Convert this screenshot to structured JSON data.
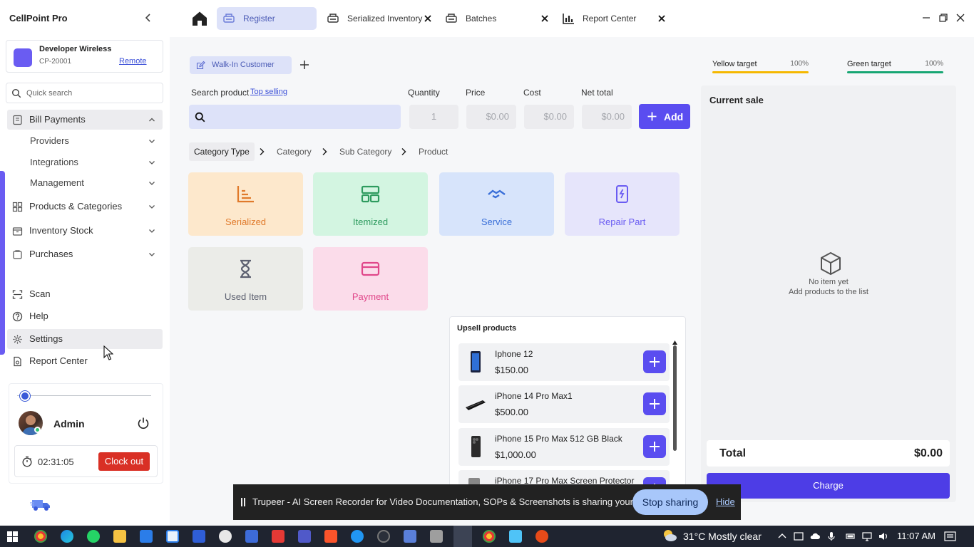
{
  "app": {
    "title": "CellPoint Pro"
  },
  "store": {
    "name": "Developer Wireless",
    "code": "CP-20001",
    "mode": "Remote"
  },
  "quick_search": {
    "placeholder": "Quick search"
  },
  "sidebar": {
    "items": [
      {
        "label": "Bill Payments",
        "icon": "receipt-icon",
        "expanded": true
      },
      {
        "label": "Providers",
        "sub": true
      },
      {
        "label": "Integrations",
        "sub": true
      },
      {
        "label": "Management",
        "sub": true
      },
      {
        "label": "Products & Categories",
        "icon": "grid-icon"
      },
      {
        "label": "Inventory Stock",
        "icon": "box-icon"
      },
      {
        "label": "Purchases",
        "icon": "cart-icon"
      },
      {
        "label": "Scan",
        "icon": "scan-icon"
      },
      {
        "label": "Help",
        "icon": "help-icon"
      },
      {
        "label": "Settings",
        "icon": "gear-icon"
      },
      {
        "label": "Report Center",
        "icon": "report-icon"
      }
    ]
  },
  "user": {
    "name": "Admin",
    "timer": "02:31:05",
    "clock_out": "Clock out"
  },
  "tabs": [
    {
      "label": "Register",
      "icon": "register-icon",
      "active": true
    },
    {
      "label": "Serialized Inventory",
      "icon": "printer-icon"
    },
    {
      "label": "Batches",
      "icon": "printer-icon"
    },
    {
      "label": "Report Center",
      "icon": "bar-chart-icon"
    }
  ],
  "customer": {
    "label": "Walk-In Customer"
  },
  "form": {
    "search_label": "Search product",
    "top_selling": "Top selling",
    "quantity_label": "Quantity",
    "quantity_value": "1",
    "price_label": "Price",
    "price_value": "$0.00",
    "cost_label": "Cost",
    "cost_value": "$0.00",
    "net_label": "Net total",
    "net_value": "$0.00",
    "add_label": "Add"
  },
  "breadcrumb": [
    "Category Type",
    "Category",
    "Sub Category",
    "Product"
  ],
  "categories": [
    {
      "label": "Serialized",
      "bg": "#fde8cc",
      "fg": "#e07a2b"
    },
    {
      "label": "Itemized",
      "bg": "#d3f5e1",
      "fg": "#2e9b5f"
    },
    {
      "label": "Service",
      "bg": "#d7e4fb",
      "fg": "#3a6fd8"
    },
    {
      "label": "Repair Part",
      "bg": "#e6e5fb",
      "fg": "#6a5cf2"
    },
    {
      "label": "Used Item",
      "bg": "#ebece8",
      "fg": "#5c6070"
    },
    {
      "label": "Payment",
      "bg": "#fbdcea",
      "fg": "#e0478a"
    }
  ],
  "upsell": {
    "title": "Upsell products",
    "items": [
      {
        "name": "Iphone 12",
        "price": "$150.00"
      },
      {
        "name": "iPhone 14 Pro Max1",
        "price": "$500.00"
      },
      {
        "name": "iPhone 15 Pro Max 512 GB Black",
        "price": "$1,000.00"
      },
      {
        "name": "iPhone 17 Pro Max Screen Protector",
        "price": ""
      }
    ]
  },
  "targets": [
    {
      "label": "Yellow target",
      "pct": "100%",
      "color": "#f5b800"
    },
    {
      "label": "Green target",
      "pct": "100%",
      "color": "#17a673"
    }
  ],
  "sale": {
    "title": "Current sale",
    "empty_title": "No item yet",
    "empty_sub": "Add products to the list",
    "total_label": "Total",
    "total_value": "$0.00",
    "charge_label": "Charge"
  },
  "share_banner": {
    "text": "Trupeer - AI Screen Recorder for Video Documentation, SOPs & Screenshots is sharing your screen.",
    "stop": "Stop sharing",
    "hide": "Hide"
  },
  "taskbar": {
    "weather": "31°C  Mostly clear",
    "time": "11:07 AM"
  },
  "colors": {
    "accent": "#5a4df0",
    "danger": "#d93025",
    "active_tab": "#dde2f9"
  }
}
